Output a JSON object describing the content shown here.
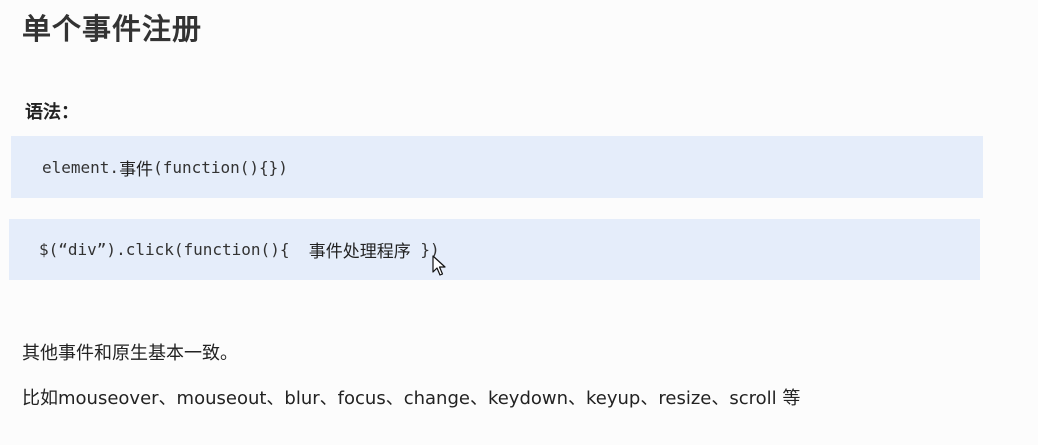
{
  "title": "单个事件注册",
  "syntax_label": "语法：",
  "code1": {
    "prefix": "element.",
    "event_word": "事件",
    "suffix": "(function(){})"
  },
  "code2": {
    "prefix": "$(“div”).click(function(){  ",
    "handler_text": "事件处理程序",
    "suffix": " })"
  },
  "paragraphs": {
    "other_events": "其他事件和原生基本一致。",
    "examples": "比如mouseover、mouseout、blur、focus、change、keydown、keyup、resize、scroll 等"
  },
  "icons": {
    "cursor": "mouse-pointer-icon"
  }
}
